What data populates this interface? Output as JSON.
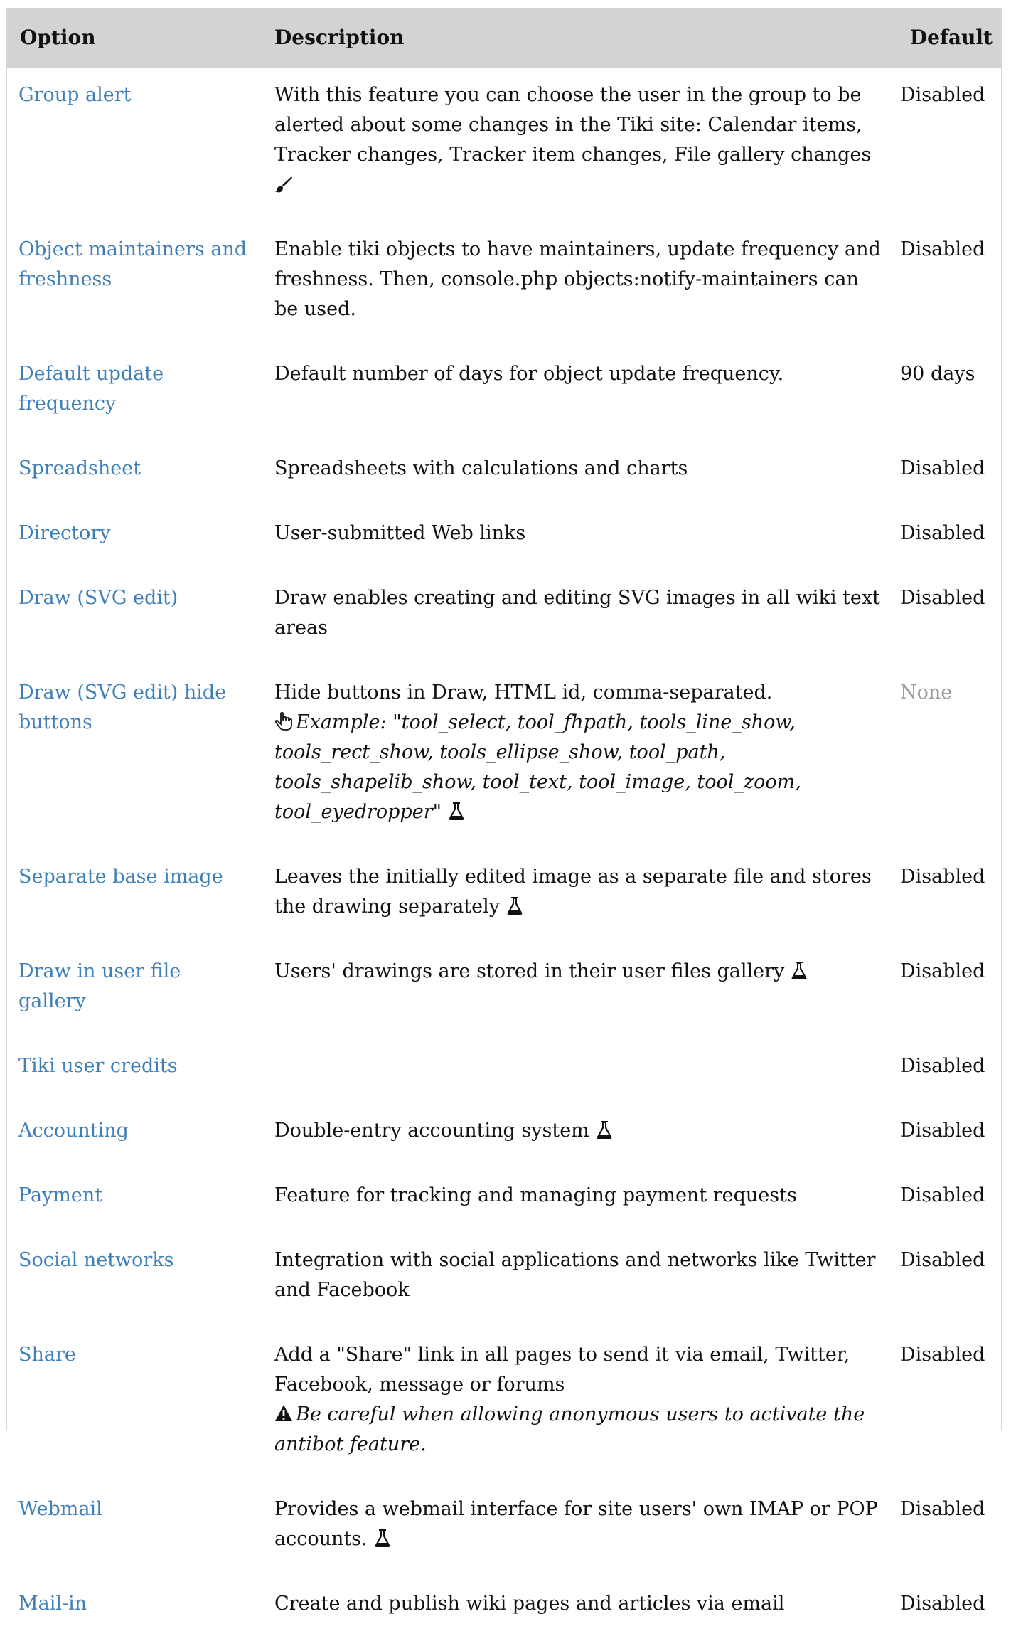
{
  "table": {
    "headers": {
      "option": "Option",
      "description": "Description",
      "default": "Default"
    },
    "rows": [
      {
        "option": "Group alert",
        "description": "With this feature you can choose the user in the group to be alerted about some changes in the Tiki site: Calendar items, Tracker changes, Tracker item changes, File gallery changes",
        "default": "Disabled",
        "icon": "brush-icon"
      },
      {
        "option": "Object maintainers and freshness",
        "description": "Enable tiki objects to have maintainers, update frequency and freshness. Then, console.php objects:notify-maintainers can be used.",
        "default": "Disabled"
      },
      {
        "option": "Default update frequency",
        "description": "Default number of days for object update frequency.",
        "default": "90 days"
      },
      {
        "option": "Spreadsheet",
        "description": "Spreadsheets with calculations and charts",
        "default": "Disabled"
      },
      {
        "option": "Directory",
        "description": "User-submitted Web links",
        "default": "Disabled"
      },
      {
        "option": "Draw (SVG edit)",
        "description": "Draw enables creating and editing SVG images in all wiki text areas",
        "default": "Disabled"
      },
      {
        "option": "Draw (SVG edit) hide buttons",
        "description": "Hide buttons in Draw, HTML id, comma-separated.",
        "example_label": "Example:",
        "example_value": "tool_select, tool_fhpath, tools_line_show, tools_rect_show, tools_ellipse_show, tool_path, tools_shapelib_show, tool_text, tool_image, tool_zoom, tool_eyedropper",
        "default": "None",
        "icon": "flask-icon"
      },
      {
        "option": "Separate base image",
        "description": "Leaves the initially edited image as a separate file and stores the drawing separately",
        "default": "Disabled",
        "icon": "flask-icon"
      },
      {
        "option": "Draw in user file gallery",
        "description": "Users' drawings are stored in their user files gallery",
        "default": "Disabled",
        "icon": "flask-icon"
      },
      {
        "option": "Tiki user credits",
        "description": "",
        "default": "Disabled"
      },
      {
        "option": "Accounting",
        "description": "Double-entry accounting system",
        "default": "Disabled",
        "icon": "flask-icon"
      },
      {
        "option": "Payment",
        "description": "Feature for tracking and managing payment requests",
        "default": "Disabled"
      },
      {
        "option": "Social networks",
        "description": "Integration with social applications and networks like Twitter and Facebook",
        "default": "Disabled"
      },
      {
        "option": "Share",
        "description": "Add a \"Share\" link in all pages to send it via email, Twitter, Facebook, message or forums",
        "warning": "Be careful when allowing anonymous users to activate the antibot feature.",
        "default": "Disabled",
        "icon": "warning-icon"
      },
      {
        "option": "Webmail",
        "description": "Provides a webmail interface for site users' own IMAP or POP accounts.",
        "default": "Disabled",
        "icon": "flask-icon"
      },
      {
        "option": "Mail-in",
        "description": "Create and publish wiki pages and articles via email",
        "default": "Disabled"
      }
    ]
  },
  "colors": {
    "link": "#3f7fb8",
    "header_bg": "#d3d3d3",
    "muted": "#9a9a9a"
  }
}
